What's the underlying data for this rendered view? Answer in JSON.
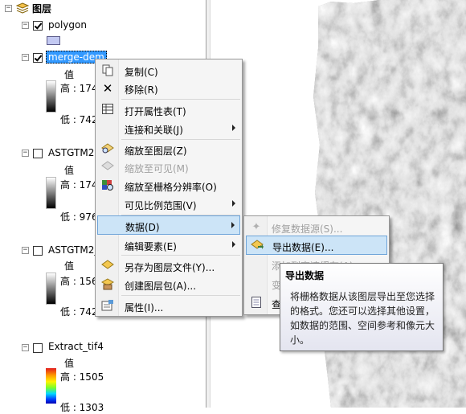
{
  "toc": {
    "root_label": "图层",
    "layers": [
      {
        "name": "polygon",
        "checked": true
      },
      {
        "name": "merge-dem",
        "checked": true,
        "selected": true,
        "legend_title": "值",
        "high_label": "高 : 174",
        "low_label": "低 : 742"
      },
      {
        "name": "ASTGTM2",
        "checked": false,
        "legend_title": "值",
        "high_label": "高 : 174",
        "low_label": "低 : 976"
      },
      {
        "name": "ASTGTM2_",
        "checked": false,
        "legend_title": "值",
        "high_label": "高 : 156",
        "low_label": "低 : 742"
      },
      {
        "name": "Extract_tif4",
        "checked": false,
        "legend_title": "值",
        "high_label": "高 : 1505",
        "low_label": "低 : 1303"
      }
    ]
  },
  "context_menu": {
    "items": [
      {
        "label": "复制(C)",
        "icon": "copy-icon"
      },
      {
        "label": "移除(R)",
        "icon": "remove-icon"
      },
      {
        "label": "打开属性表(T)",
        "icon": "table-icon"
      },
      {
        "label": "连接和关联(J)",
        "submenu": true
      },
      {
        "label": "缩放至图层(Z)",
        "icon": "zoom-layer-icon"
      },
      {
        "label": "缩放至可见(M)",
        "icon": "zoom-visible-icon",
        "disabled": true
      },
      {
        "label": "缩放至栅格分辨率(O)",
        "icon": "zoom-raster-icon"
      },
      {
        "label": "可见比例范围(V)",
        "submenu": true
      },
      {
        "label": "数据(D)",
        "submenu": true,
        "highlighted": true
      },
      {
        "label": "编辑要素(E)",
        "submenu": true
      },
      {
        "label": "另存为图层文件(Y)...",
        "icon": "save-layer-icon"
      },
      {
        "label": "创建图层包(A)...",
        "icon": "layer-package-icon"
      },
      {
        "label": "属性(I)...",
        "icon": "properties-icon"
      }
    ]
  },
  "data_submenu": {
    "items": [
      {
        "label": "修复数据源(S)...",
        "disabled": true
      },
      {
        "label": "导出数据(E)...",
        "highlighted": true
      },
      {
        "label": "添加到高速缓存(A)",
        "disabled": true
      },
      {
        "label": "变",
        "disabled": true
      },
      {
        "label": "查"
      }
    ]
  },
  "tooltip": {
    "title": "导出数据",
    "body": "将栅格数据从该图层导出至您选择的格式。您还可以选择其他设置，如数据的范围、空间参考和像元大小。"
  },
  "colors": {
    "selection": "#3399ff",
    "menu_highlight": "#cce4f7",
    "menu_highlight_border": "#6ea4d9"
  }
}
